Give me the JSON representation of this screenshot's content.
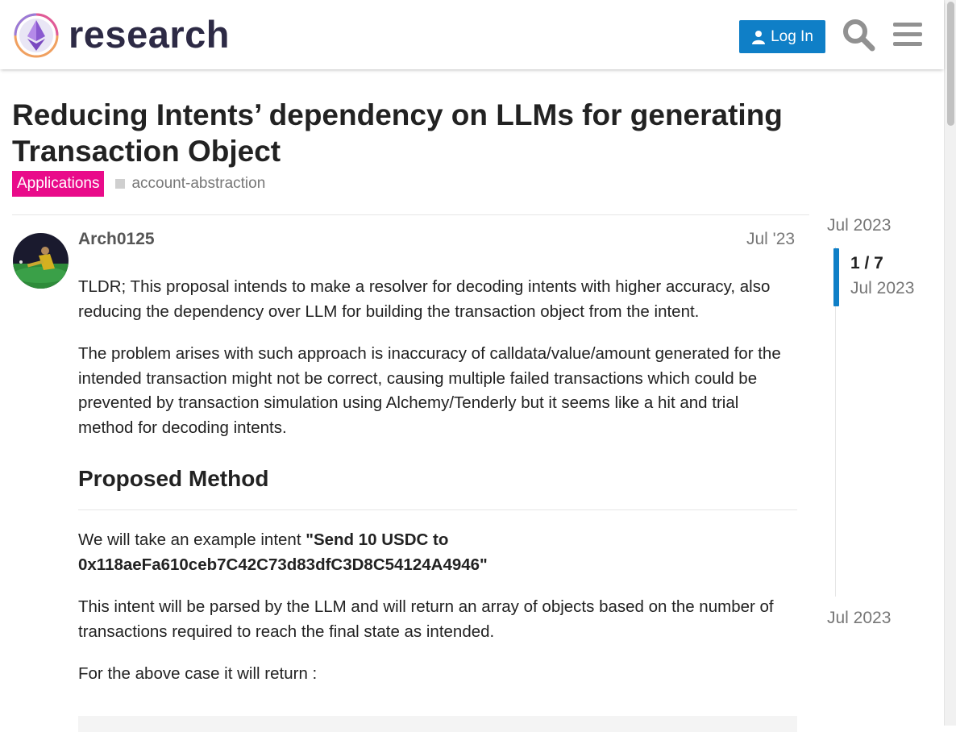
{
  "header": {
    "site_name": "research",
    "login_label": "Log In",
    "accent_color": "#0f7fc7"
  },
  "topic": {
    "title": "Reducing Intents’ dependency on LLMs for generating Transaction Object",
    "category": "Applications",
    "category_color": "#e90b8a",
    "tag": "account-abstraction"
  },
  "post": {
    "username": "Arch0125",
    "date": "Jul '23",
    "paragraphs": [
      "TLDR; This proposal intends to make a resolver for decoding intents with higher accuracy, also reducing the dependency over LLM for building the transaction object from the intent.",
      "The problem arises with such approach is inaccuracy of calldata/value/amount generated for the intended transaction might not be correct, causing multiple failed transactions which could be prevented by transaction simulation using Alchemy/Tenderly but it seems like a hit and trial method for decoding intents."
    ],
    "heading": "Proposed Method",
    "example_prefix": "We will take an example intent ",
    "example_intent": "\"Send 10 USDC to 0x118aeFa610ceb7C42C73d83dfC3D8C54124A4946\"",
    "paragraph_after_example": "This intent will be parsed by the LLM and will return an array of objects based on the number of transactions required to reach the final state as intended.",
    "paragraph_return": "For the above case it will return :"
  },
  "timeline": {
    "start_date": "Jul 2023",
    "position": "1 / 7",
    "handle_date": "Jul 2023",
    "end_date": "Jul 2023"
  },
  "icons": {
    "logo": "research-logo",
    "login": "user-icon",
    "search": "search-icon",
    "menu": "hamburger-menu-icon"
  }
}
